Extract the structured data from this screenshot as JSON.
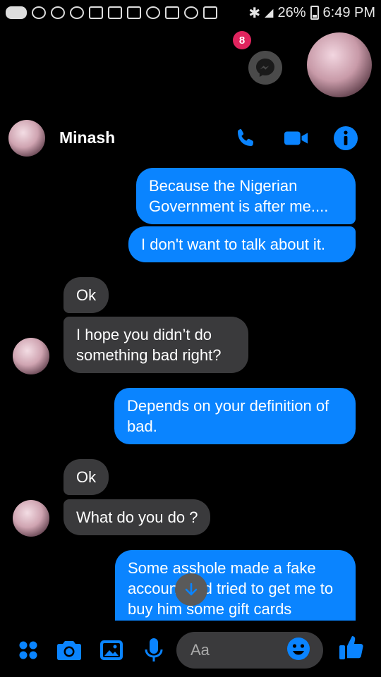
{
  "status_bar": {
    "battery": "26%",
    "time": "6:49 PM"
  },
  "chat_heads": {
    "unread_count": "8"
  },
  "header": {
    "name": "Minash"
  },
  "messages": [
    {
      "dir": "out",
      "text": "Because the Nigerian Government is after me...."
    },
    {
      "dir": "out",
      "text": "I don't want to talk about it."
    },
    {
      "dir": "in",
      "text": "Ok"
    },
    {
      "dir": "in",
      "text": "I hope you didn’t do something bad right?"
    },
    {
      "dir": "out",
      "text": "Depends on your definition of bad."
    },
    {
      "dir": "in",
      "text": "Ok"
    },
    {
      "dir": "in",
      "text": "What do you do ?"
    },
    {
      "dir": "out",
      "text": "Some asshole made a fake account and tried to get me to buy him some gift cards"
    }
  ],
  "composer": {
    "placeholder": "Aa"
  },
  "colors": {
    "accent": "#0a84ff",
    "incoming": "#3a3a3c",
    "badge": "#e0245e"
  },
  "icons": [
    "phone-icon",
    "video-icon",
    "info-icon",
    "apps-icon",
    "camera-icon",
    "gallery-icon",
    "mic-icon",
    "emoji-icon",
    "thumbs-up-icon",
    "arrow-down-icon",
    "messenger-icon"
  ]
}
